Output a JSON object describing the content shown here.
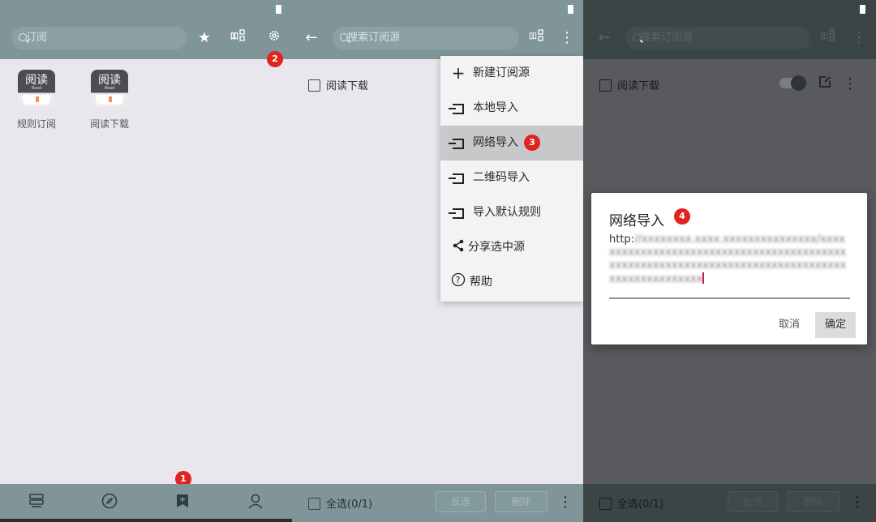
{
  "panel1": {
    "search_placeholder": "订阅",
    "toolbar_icons": [
      "star-icon",
      "group-icon",
      "settings-icon"
    ],
    "badge_settings": "2",
    "apps": [
      {
        "title": "阅读",
        "sub": "Read",
        "label": "规则订阅"
      },
      {
        "title": "阅读",
        "sub": "Read",
        "label": "阅读下载"
      }
    ],
    "nav": [
      "bookshelf-icon",
      "explore-icon",
      "rss-bookmark-icon",
      "profile-icon"
    ],
    "badge_nav": "1"
  },
  "panel2": {
    "search_placeholder": "搜索订阅源",
    "list_item": "阅读下载",
    "menu": [
      {
        "icon": "plus-icon",
        "label": "新建订阅源"
      },
      {
        "icon": "import-icon",
        "label": "本地导入"
      },
      {
        "icon": "import-icon",
        "label": "网络导入"
      },
      {
        "icon": "import-icon",
        "label": "二维码导入"
      },
      {
        "icon": "import-icon",
        "label": "导入默认规则"
      },
      {
        "icon": "share-icon",
        "label": "分享选中源"
      },
      {
        "icon": "help-icon",
        "label": "帮助"
      }
    ],
    "badge_menu": "3",
    "select_all": "全选(0/1)",
    "invert_label": "反选",
    "delete_label": "删除"
  },
  "panel3": {
    "search_placeholder": "搜索订阅源",
    "list_item": "阅读下载",
    "toggle_on": true,
    "dialog": {
      "title": "网络导入",
      "badge": "4",
      "url_prefix": "http:",
      "cancel_label": "取消",
      "ok_label": "确定"
    },
    "select_all": "全选(0/1)",
    "invert_label": "反选",
    "delete_label": "删除"
  },
  "colors": {
    "toolbar": "#7f9597",
    "background": "#e9e6ed",
    "badge": "#e0241f",
    "overlay": "#595a5d"
  }
}
